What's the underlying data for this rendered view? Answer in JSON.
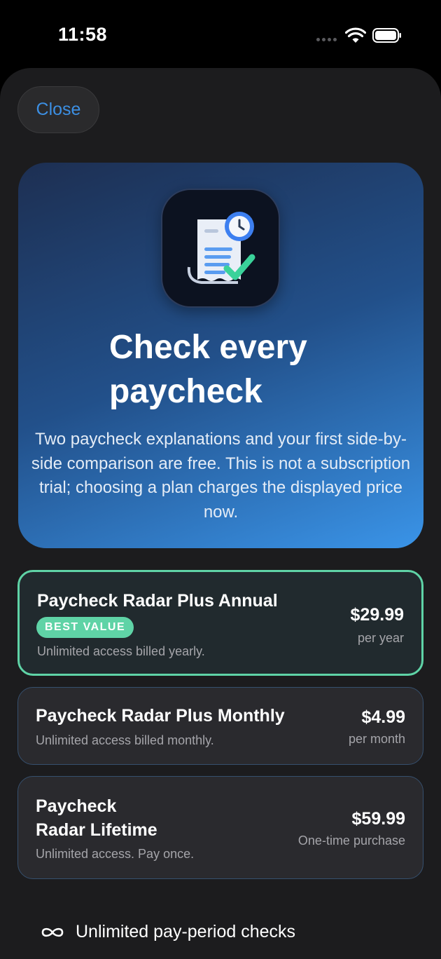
{
  "status_bar": {
    "time": "11:58"
  },
  "close_label": "Close",
  "hero": {
    "title": "Check every paycheck",
    "subtitle": "Two paycheck explanations and your first side-by-side comparison are free. This is not a subscription trial; choosing a plan charges the displayed price now."
  },
  "plans": [
    {
      "name": "Paycheck Radar Plus Annual",
      "badge": "BEST VALUE",
      "description": "Unlimited access billed yearly.",
      "price": "$29.99",
      "period": "per year",
      "selected": true
    },
    {
      "name": "Paycheck Radar Plus Monthly",
      "description": "Unlimited access billed monthly.",
      "price": "$4.99",
      "period": "per month",
      "selected": false
    },
    {
      "name": "Paycheck\nRadar Lifetime",
      "description": "Unlimited access. Pay once.",
      "price": "$59.99",
      "period": "One-time purchase",
      "selected": false
    }
  ],
  "feature": {
    "icon": "infinity-icon",
    "text": "Unlimited pay-period checks"
  },
  "colors": {
    "accent_blue": "#3c8fe3",
    "selected_green": "#5fd3a6",
    "background": "#1c1c1e"
  }
}
